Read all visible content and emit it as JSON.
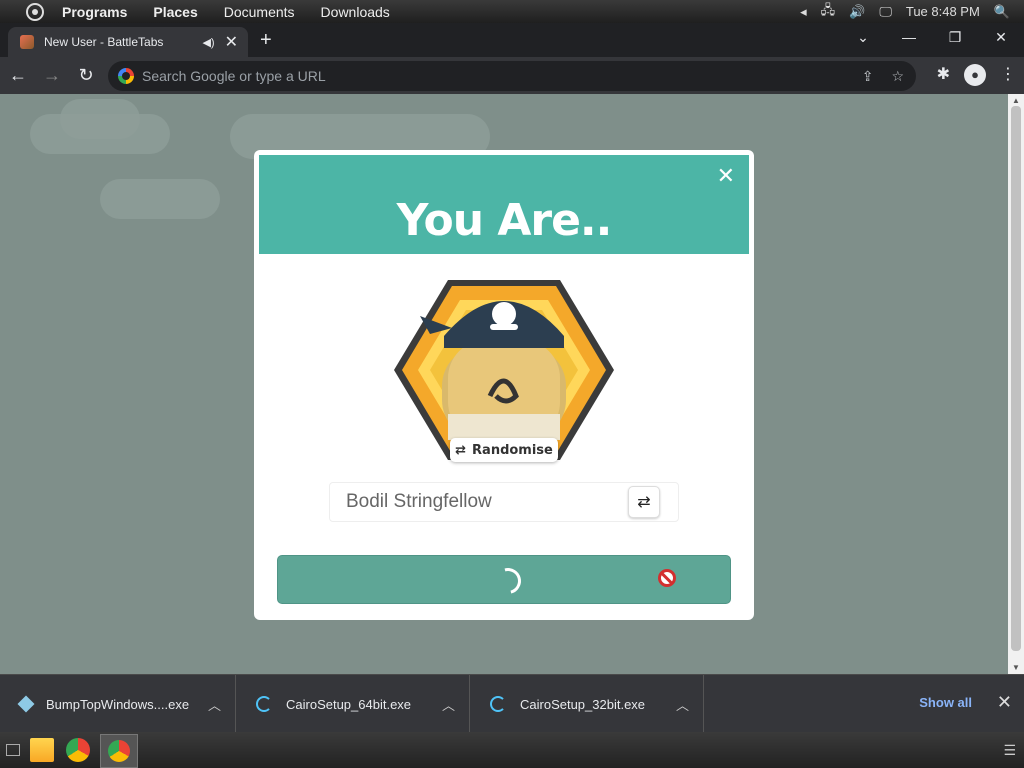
{
  "topbar": {
    "menus": [
      "Programs",
      "Places",
      "Documents",
      "Downloads"
    ],
    "clock": "Tue 8:48 PM"
  },
  "browser": {
    "tab_title": "New User - BattleTabs",
    "omnibox_placeholder": "Search Google or type a URL"
  },
  "modal": {
    "title": "You Are..",
    "randomise_label": "Randomise",
    "name_value": "Bodil Stringfellow"
  },
  "downloads": {
    "items": [
      "BumpTopWindows....exe",
      "CairoSetup_64bit.exe",
      "CairoSetup_32bit.exe"
    ],
    "show_all": "Show all"
  },
  "colors": {
    "accent": "#4cb5a6",
    "button": "#5ea696",
    "backdrop": "#7f8f8a"
  }
}
